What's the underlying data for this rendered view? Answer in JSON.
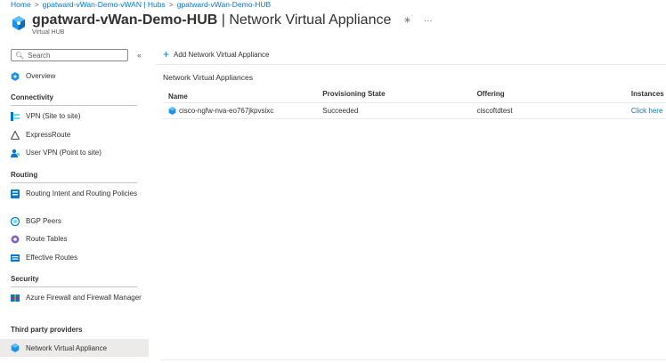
{
  "breadcrumb": {
    "items": [
      "Home",
      "gpatward-vWan-Demo-vWAN | Hubs",
      "gpatward-vWan-Demo-HUB"
    ]
  },
  "header": {
    "title_bold": "gpatward-vWan-Demo-HUB",
    "title_rest": " | Network Virtual Appliance",
    "subtitle": "Virtual HUB",
    "more": "···",
    "pin": "✳"
  },
  "sidebar": {
    "search_placeholder": "Search",
    "collapse": "«",
    "overview": "Overview",
    "sections": {
      "connectivity": "Connectivity",
      "routing": "Routing",
      "security": "Security",
      "third_party": "Third party providers"
    },
    "items": {
      "vpn": "VPN (Site to site)",
      "expressroute": "ExpressRoute",
      "user_vpn": "User VPN (Point to site)",
      "routing_intent": "Routing Intent and Routing Policies",
      "bgp_peers": "BGP Peers",
      "route_tables": "Route Tables",
      "effective_routes": "Effective Routes",
      "firewall": "Azure Firewall and Firewall Manager",
      "nva": "Network Virtual Appliance"
    }
  },
  "main": {
    "toolbar": {
      "add_label": "Add Network Virtual Appliance",
      "add_icon": "+"
    },
    "section_title": "Network Virtual Appliances",
    "columns": [
      "Name",
      "Provisioning State",
      "Offering",
      "Instances"
    ],
    "rows": [
      {
        "name": "cisco-ngfw-nva-eo767jkpvsixc",
        "state": "Succeeded",
        "offering": "ciscoftdtest",
        "instances": "Click here"
      }
    ]
  },
  "colors": {
    "accent": "#0078d4",
    "selected_bg": "#edebe9",
    "text": "#323130"
  }
}
